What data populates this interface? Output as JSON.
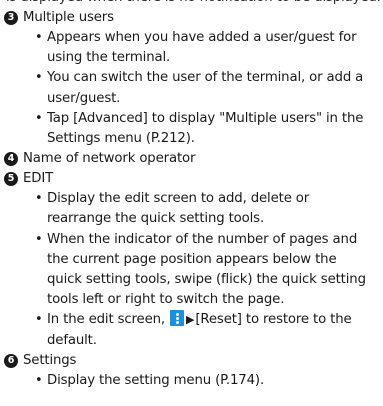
{
  "cutoff_line": "is displayed when there is no notification to be displayed.",
  "sections": [
    {
      "number": "3",
      "title": "Multiple users",
      "bullets": [
        {
          "text": "Appears when you have added a user/guest for using the terminal."
        },
        {
          "text": "You can switch the user of the terminal, or add a user/guest."
        },
        {
          "text": "Tap [Advanced] to display \"Multiple users\" in the Settings menu (P.212)."
        }
      ]
    },
    {
      "number": "4",
      "title": "Name of network operator",
      "bullets": []
    },
    {
      "number": "5",
      "title": "EDIT",
      "bullets": [
        {
          "text": "Display the edit screen to add, delete or rearrange the quick setting tools."
        },
        {
          "text": "When the indicator of the number of pages and the current page position appears below the quick setting tools, swipe (flick) the quick setting tools left or right to switch the page."
        },
        {
          "text_before": "In the edit screen,",
          "arrow": "▶",
          "text_after": "[Reset] to restore to the default.",
          "icon": "menu-kebab-icon"
        }
      ]
    },
    {
      "number": "6",
      "title": "Settings",
      "bullets": [
        {
          "text": "Display the setting menu (P.174)."
        }
      ]
    }
  ],
  "colors": {
    "text": "#1a1a1a",
    "badge": "#1a1a1a",
    "menu_icon": "#1e8fd8"
  }
}
